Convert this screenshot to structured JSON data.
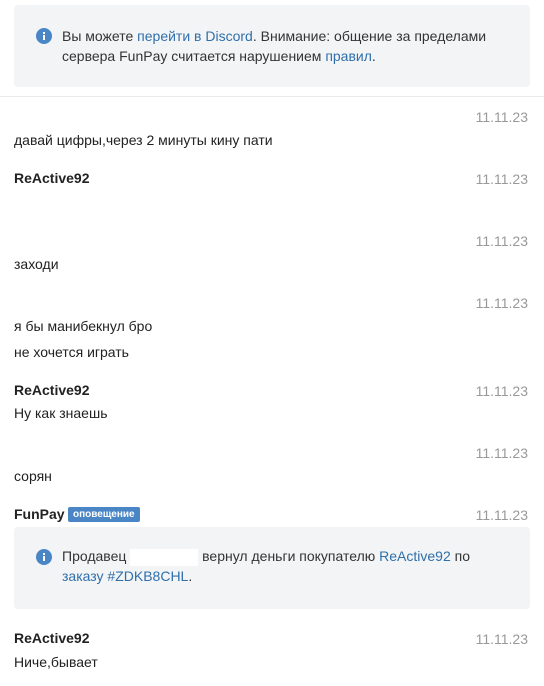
{
  "notice": {
    "pre": "Вы можете ",
    "link_discord": "перейти в Discord",
    "mid": ". Внимание: общение за пределами сервера FunPay считается нарушением ",
    "link_rules": "правил",
    "post": "."
  },
  "messages": [
    {
      "time": "11.11.23",
      "text": "давай цифры,через 2 минуты кину пати"
    },
    {
      "author": "ReActive92",
      "time": "11.11.23"
    },
    {
      "time": "11.11.23",
      "text": "заходи"
    },
    {
      "time": "11.11.23",
      "text": "я бы манибекнул бро",
      "text2": "не хочется играть"
    },
    {
      "author": "ReActive92",
      "time": "11.11.23",
      "text": "Ну как знаешь"
    },
    {
      "time": "11.11.23",
      "text": "сорян"
    },
    {
      "author": "FunPay",
      "badge": "оповещение",
      "time": "11.11.23"
    },
    {
      "author": "ReActive92",
      "time": "11.11.23",
      "text": "Ниче,бывает"
    }
  ],
  "system_notice": {
    "pre": "Продавец ",
    "mid": " вернул деньги покупателю ",
    "buyer_link": "ReActive92",
    "by": " по ",
    "order_link": "заказу #ZDKB8CHL",
    "post": "."
  },
  "colors": {
    "link": "#2f6faa",
    "badge": "#4a86c6",
    "alert_bg": "#f3f4f6",
    "timestamp": "#999999"
  }
}
